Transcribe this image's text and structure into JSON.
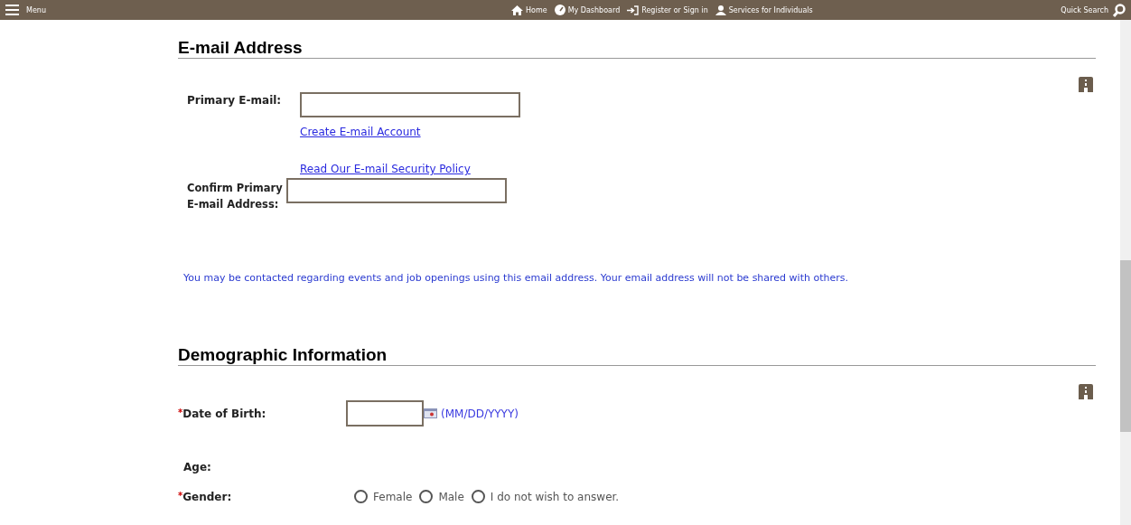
{
  "top_bar": {
    "menu_label": "Menu",
    "nav": [
      {
        "label": "Home"
      },
      {
        "label": "My Dashboard"
      },
      {
        "label": "Register or Sign in"
      },
      {
        "label": "Services for Individuals"
      }
    ],
    "search_label": "Quick Search"
  },
  "email_section": {
    "heading": "E-mail Address",
    "primary_label": "Primary E-mail:",
    "create_link": "Create E-mail Account",
    "policy_link": "Read Our E-mail Security Policy",
    "confirm_label": "Confirm Primary E-mail Address:",
    "notice": "You may be contacted regarding events and job openings using this email address. Your email address will not be shared with others."
  },
  "demographic_section": {
    "heading": "Demographic Information",
    "dob": {
      "required_mark": "*",
      "label": "Date of Birth:",
      "format_hint": "(MM/DD/YYYY)"
    },
    "age": {
      "label": "Age:"
    },
    "gender": {
      "required_mark": "*",
      "label": "Gender:",
      "options": [
        {
          "label": "Female",
          "selected": false
        },
        {
          "label": "Male",
          "selected": false
        },
        {
          "label": "I do not wish to answer.",
          "selected": false
        }
      ]
    }
  }
}
